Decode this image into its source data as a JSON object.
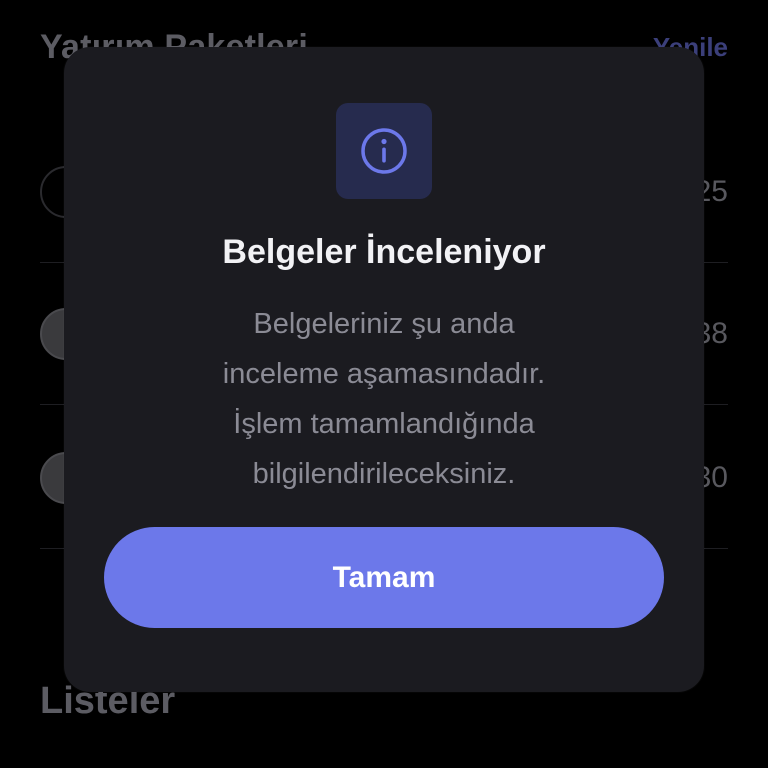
{
  "background": {
    "title": "Yatırım Paketleri",
    "refresh_label": "Yenile",
    "rows": [
      {
        "value": "25"
      },
      {
        "value": "38"
      },
      {
        "value": "30"
      }
    ],
    "lists_heading": "Listeler"
  },
  "modal": {
    "icon": "info-icon",
    "title": "Belgeler İnceleniyor",
    "body_lines": [
      "Belgeleriniz şu anda",
      "inceleme aşamasındadır.",
      "İşlem tamamlandığında",
      "bilgilendirileceksiniz."
    ],
    "ok_label": "Tamam"
  },
  "colors": {
    "accent": "#6c78ea",
    "modal_bg": "#1b1b20",
    "icon_tile": "#262b4e"
  }
}
